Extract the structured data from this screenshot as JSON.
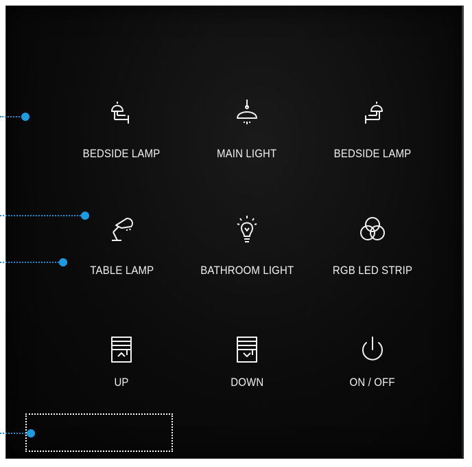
{
  "panel": {
    "keys": [
      {
        "label": "BEDSIDE LAMP",
        "icon": "bedside-lamp-left-icon"
      },
      {
        "label": "MAIN LIGHT",
        "icon": "ceiling-light-icon"
      },
      {
        "label": "BEDSIDE LAMP",
        "icon": "bedside-lamp-right-icon"
      },
      {
        "label": "TABLE LAMP",
        "icon": "desk-lamp-icon"
      },
      {
        "label": "BATHROOM LIGHT",
        "icon": "light-bulb-icon"
      },
      {
        "label": "RGB LED STRIP",
        "icon": "rgb-circles-icon"
      },
      {
        "label": "UP",
        "icon": "blind-up-icon"
      },
      {
        "label": "DOWN",
        "icon": "blind-down-icon"
      },
      {
        "label": "ON / OFF",
        "icon": "power-icon"
      }
    ]
  },
  "colors": {
    "panel_bg": "#0b0b0b",
    "label_text": "#f2f2f2",
    "callout_accent": "#1e9ae0"
  }
}
